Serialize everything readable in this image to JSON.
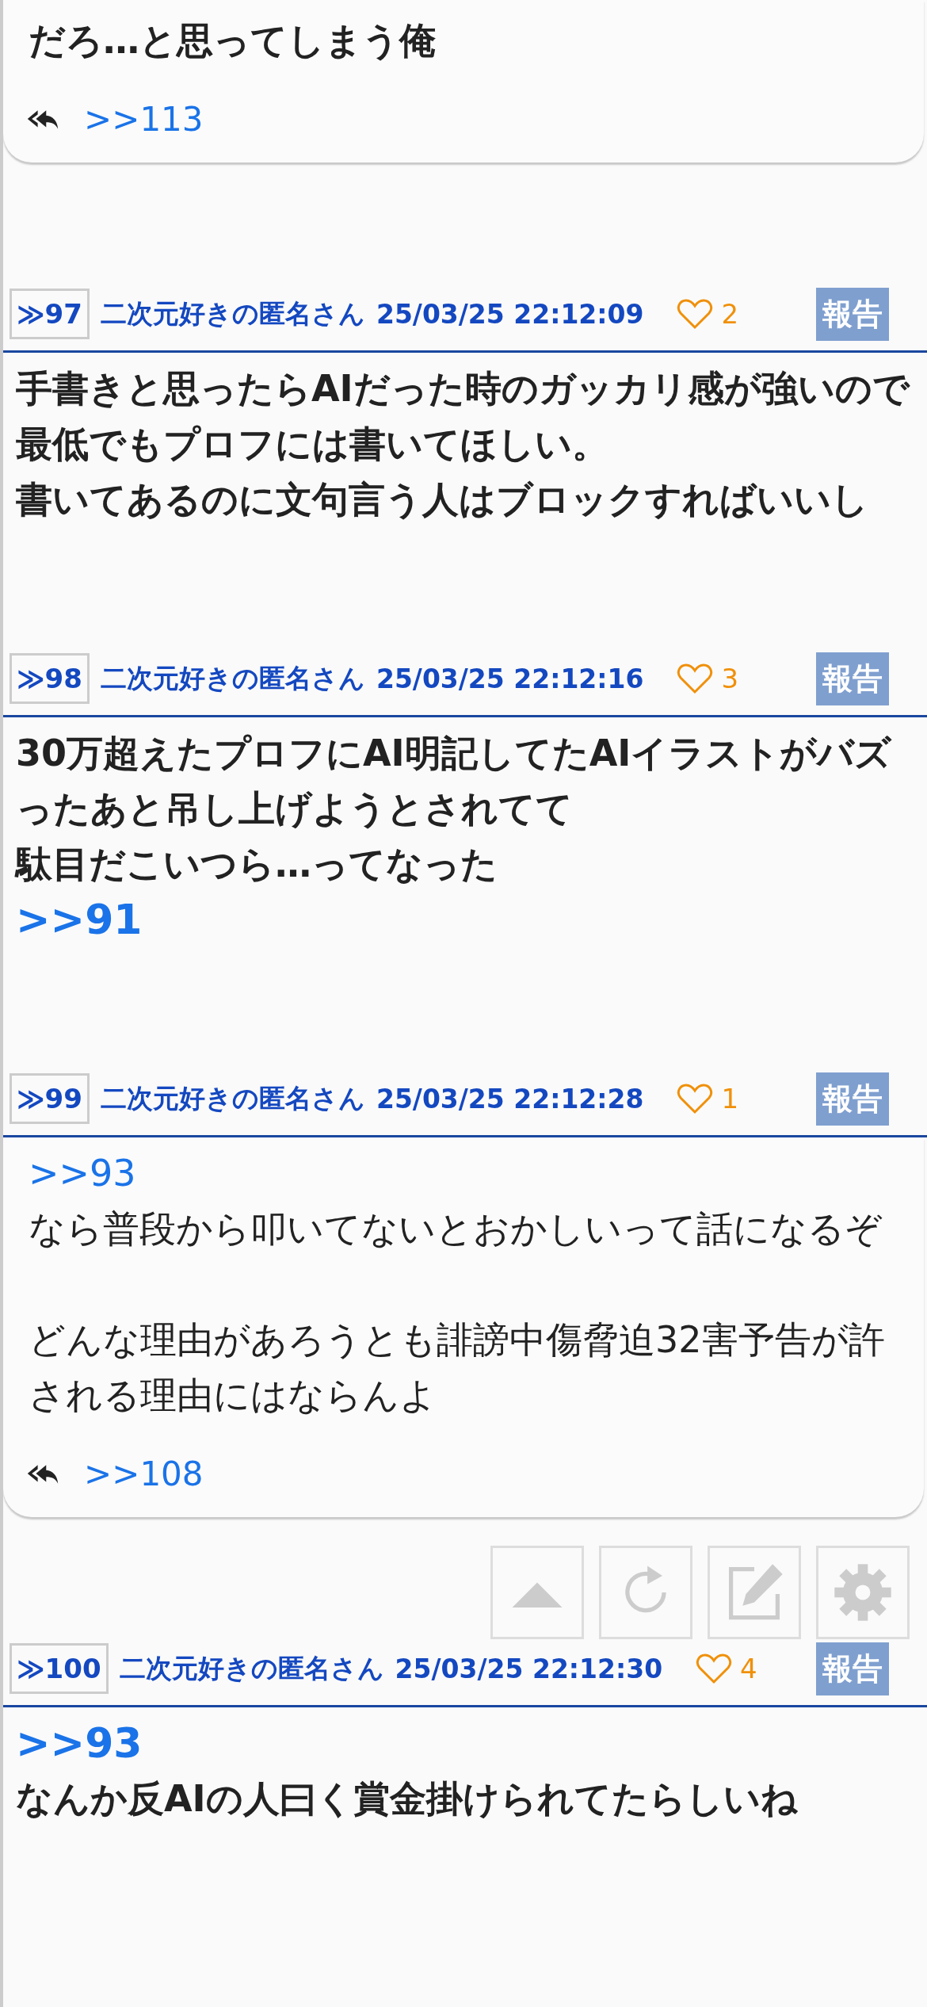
{
  "previous_post_tail": {
    "bold": true,
    "body": [
      {
        "kind": "text",
        "text": "だろ…と思ってしまう俺"
      }
    ],
    "replies": [
      ">>113"
    ]
  },
  "posts": [
    {
      "number": "≫97",
      "name": "二次元好きの匿名さん",
      "date": "25/03/25 22:12:09",
      "likes": "2",
      "report": "報告",
      "bold": true,
      "body": [
        {
          "kind": "text",
          "text": "手書きと思ったらAIだった時のガッカリ感が強いので最低でもプロフには書いてほしい。"
        },
        {
          "kind": "text",
          "text": "書いてあるのに文句言う人はブロックすればいいし"
        }
      ]
    },
    {
      "number": "≫98",
      "name": "二次元好きの匿名さん",
      "date": "25/03/25 22:12:16",
      "likes": "3",
      "report": "報告",
      "bold": true,
      "body": [
        {
          "kind": "text",
          "text": "30万超えたプロフにAI明記してたAIイラストがバズったあと吊し上げようとされてて"
        },
        {
          "kind": "text",
          "text": "駄目だこいつら…ってなった"
        },
        {
          "kind": "anchor",
          "text": ">>91"
        }
      ]
    },
    {
      "number": "≫99",
      "name": "二次元好きの匿名さん",
      "date": "25/03/25 22:12:28",
      "likes": "1",
      "report": "報告",
      "bold": false,
      "body": [
        {
          "kind": "anchor",
          "text": ">>93"
        },
        {
          "kind": "text",
          "text": "なら普段から叩いてないとおかしいって話になるぞ"
        },
        {
          "kind": "blank_line"
        },
        {
          "kind": "text",
          "text": "どんな理由があろうとも誹謗中傷脅迫32害予告が許される理由にはならんよ"
        }
      ],
      "replies": [
        ">>108"
      ]
    },
    {
      "number": "≫100",
      "name": "二次元好きの匿名さん",
      "date": "25/03/25 22:12:30",
      "likes": "4",
      "report": "報告",
      "bold": true,
      "body": [
        {
          "kind": "anchor",
          "text": ">>93"
        },
        {
          "kind": "text",
          "text": "なんか反AIの人曰く賞金掛けられてたらしいね"
        }
      ]
    }
  ],
  "floating_buttons": [
    {
      "kind": "top"
    },
    {
      "kind": "reload"
    },
    {
      "kind": "edit"
    },
    {
      "kind": "settings"
    }
  ]
}
